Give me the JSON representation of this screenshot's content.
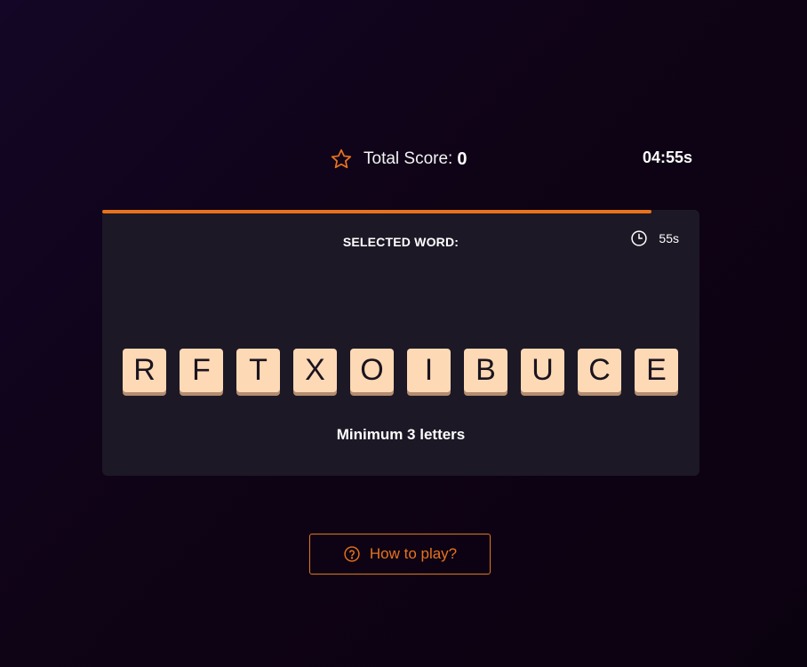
{
  "header": {
    "score_label": "Total Score:",
    "score_value": "0",
    "total_timer": "04:55s",
    "star_icon": "star-icon"
  },
  "round": {
    "progress_fraction": 0.92,
    "selected_word_label": "SELECTED WORD:",
    "selected_word": "",
    "timer": "55s",
    "timer_icon": "clock-icon",
    "min_letters_text": "Minimum 3 letters"
  },
  "tiles": [
    "R",
    "F",
    "T",
    "X",
    "O",
    "I",
    "B",
    "U",
    "C",
    "E"
  ],
  "how_to_play": {
    "label": "How to play?",
    "icon": "help-circle-icon"
  },
  "colors": {
    "accent": "#e8731c",
    "tile": "#fdd9b5",
    "tile_shadow": "#b28d70",
    "card": "#1d1826",
    "background": "#0f0316"
  }
}
